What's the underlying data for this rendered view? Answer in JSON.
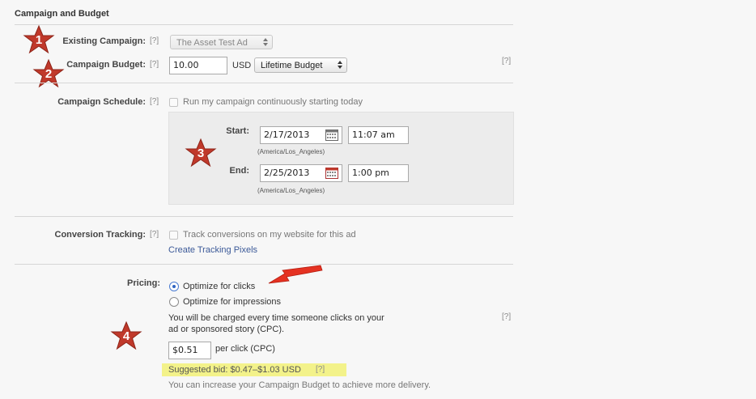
{
  "section": {
    "title": "Campaign and Budget"
  },
  "help_marker": "[?]",
  "markers": [
    "1",
    "2",
    "3",
    "4"
  ],
  "existing_campaign": {
    "label": "Existing Campaign:",
    "value": "The Asset Test Ad"
  },
  "campaign_budget": {
    "label": "Campaign Budget:",
    "amount": "10.00",
    "currency": "USD",
    "type": "Lifetime Budget"
  },
  "schedule": {
    "label": "Campaign Schedule:",
    "continuous_label": "Run my campaign continuously starting today",
    "start_label": "Start:",
    "start_date": "2/17/2013",
    "start_time": "11:07 am",
    "start_tz": "(America/Los_Angeles)",
    "end_label": "End:",
    "end_date": "2/25/2013",
    "end_time": "1:00 pm",
    "end_tz": "(America/Los_Angeles)"
  },
  "conversion": {
    "label": "Conversion Tracking:",
    "checkbox_label": "Track conversions on my website for this ad",
    "link": "Create Tracking Pixels"
  },
  "pricing": {
    "label": "Pricing:",
    "option_clicks": "Optimize for clicks",
    "option_impressions": "Optimize for impressions",
    "selected": "clicks",
    "note_line1": "You will be charged every time someone clicks on your",
    "note_line2": "ad or sponsored story (CPC).",
    "bid_value": "$0.51",
    "bid_unit": "per click (CPC)",
    "suggested_bid": "Suggested bid: $0.47–$1.03 USD",
    "increase_note": "You can increase your Campaign Budget to achieve more delivery."
  },
  "colors": {
    "star_fill": "#c0392b",
    "arrow": "#e53222",
    "highlight": "#f3f28a",
    "link": "#3b5998"
  }
}
